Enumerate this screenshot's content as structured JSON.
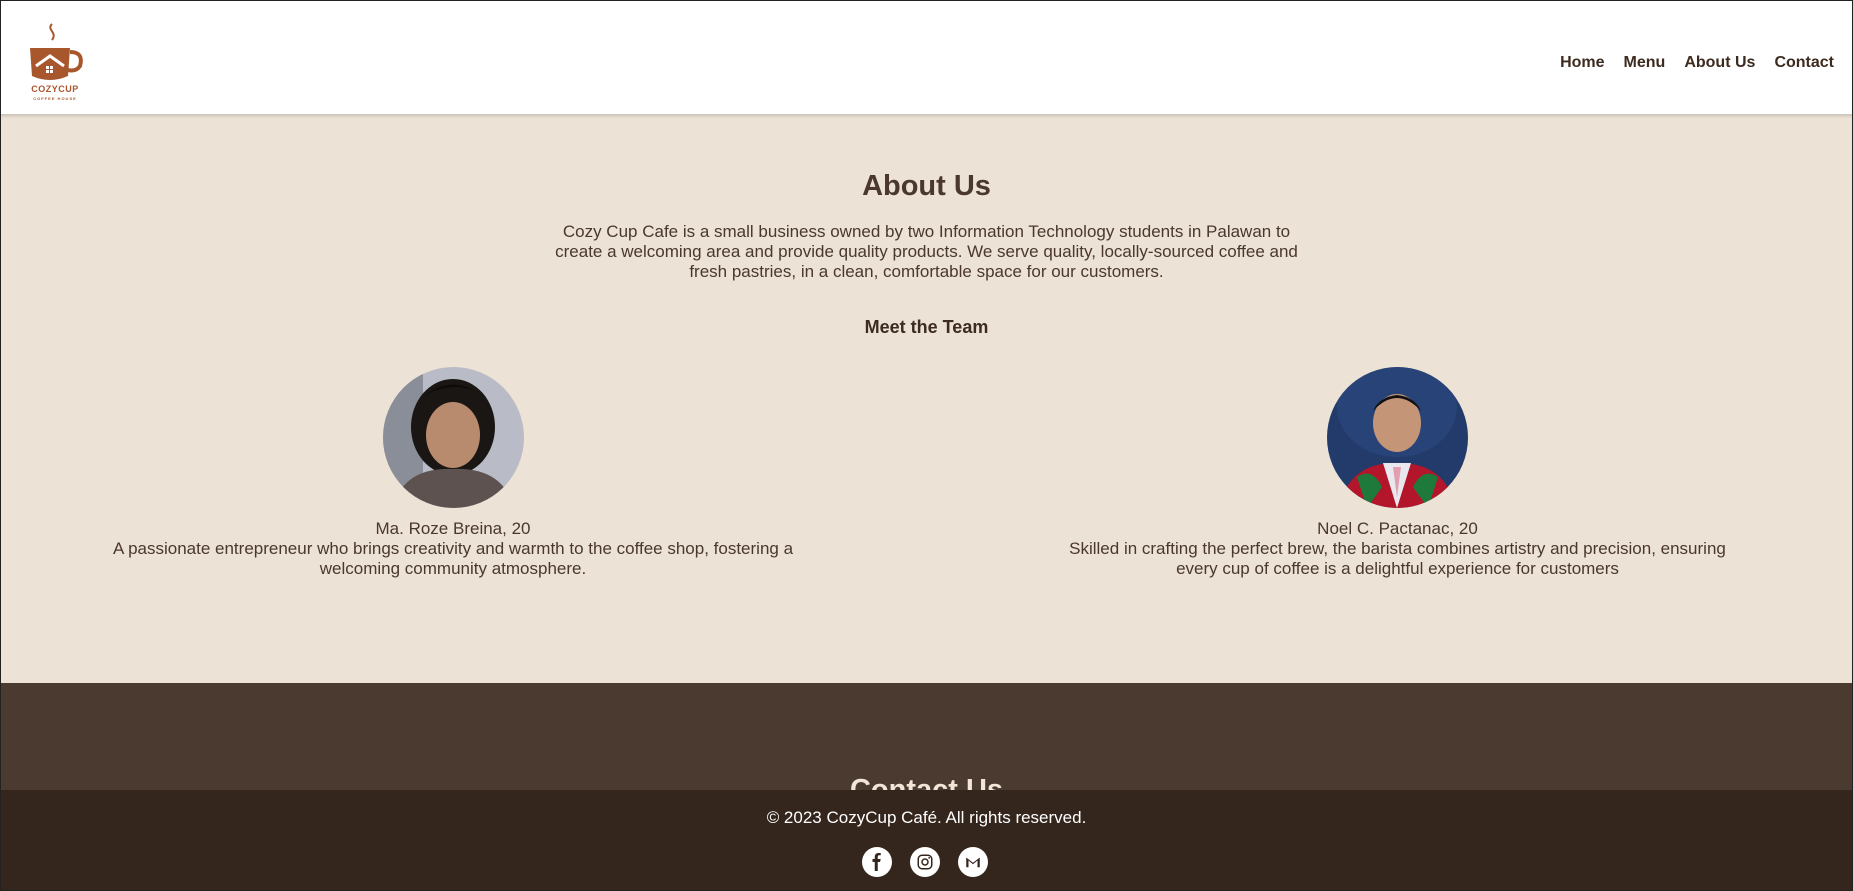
{
  "header": {
    "logo_text": "COZYCUP",
    "logo_subtext": "COFFEE HOUSE",
    "nav": [
      {
        "label": "Home"
      },
      {
        "label": "Menu"
      },
      {
        "label": "About Us"
      },
      {
        "label": "Contact"
      }
    ]
  },
  "about": {
    "title": "About Us",
    "description": "Cozy Cup Cafe is a small business owned by two Information Technology students in Palawan to create a welcoming area and provide quality products. We serve quality, locally-sourced coffee and fresh pastries, in a clean, comfortable space for our customers.",
    "team_title": "Meet the Team",
    "members": [
      {
        "name": "Ma. Roze Breina, 20",
        "bio": "A passionate entrepreneur who brings creativity and warmth to the coffee shop, fostering a welcoming community atmosphere."
      },
      {
        "name": "Noel C. Pactanac, 20",
        "bio": "Skilled in crafting the perfect brew, the barista combines artistry and precision, ensuring every cup of coffee is a delightful experience for customers"
      }
    ]
  },
  "contact": {
    "title": "Contact Us"
  },
  "footer": {
    "copyright": "© 2023 CozyCup Café. All rights reserved.",
    "socials": [
      "facebook-icon",
      "instagram-icon",
      "gmail-icon"
    ]
  },
  "colors": {
    "page_bg": "#ece2d5",
    "header_bg": "#ffffff",
    "contact_bg": "#4b3a30",
    "footer_bg": "#35261d",
    "text_dark": "#4a372d",
    "logo_brown": "#a8572d"
  }
}
